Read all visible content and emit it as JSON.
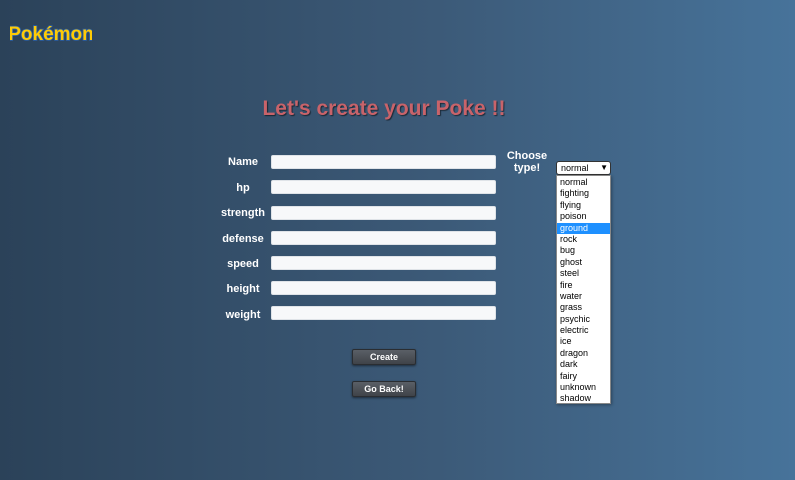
{
  "brand": {
    "logo_text": "Pokémon"
  },
  "page": {
    "title": "Let's create your Poke !!"
  },
  "form": {
    "fields": [
      {
        "label": "Name",
        "value": ""
      },
      {
        "label": "hp",
        "value": ""
      },
      {
        "label": "strength",
        "value": ""
      },
      {
        "label": "defense",
        "value": ""
      },
      {
        "label": "speed",
        "value": ""
      },
      {
        "label": "height",
        "value": ""
      },
      {
        "label": "weight",
        "value": ""
      }
    ],
    "type_label": "Choose type!",
    "type_selected": "normal",
    "type_highlighted": "ground",
    "type_options": [
      "normal",
      "fighting",
      "flying",
      "poison",
      "ground",
      "rock",
      "bug",
      "ghost",
      "steel",
      "fire",
      "water",
      "grass",
      "psychic",
      "electric",
      "ice",
      "dragon",
      "dark",
      "fairy",
      "unknown",
      "shadow"
    ],
    "create_label": "Create",
    "back_label": "Go Back!"
  },
  "colors": {
    "title": "#c8636a",
    "logo_fill": "#ffcb05",
    "logo_stroke": "#2a5fa8",
    "highlight": "#1e90ff"
  }
}
